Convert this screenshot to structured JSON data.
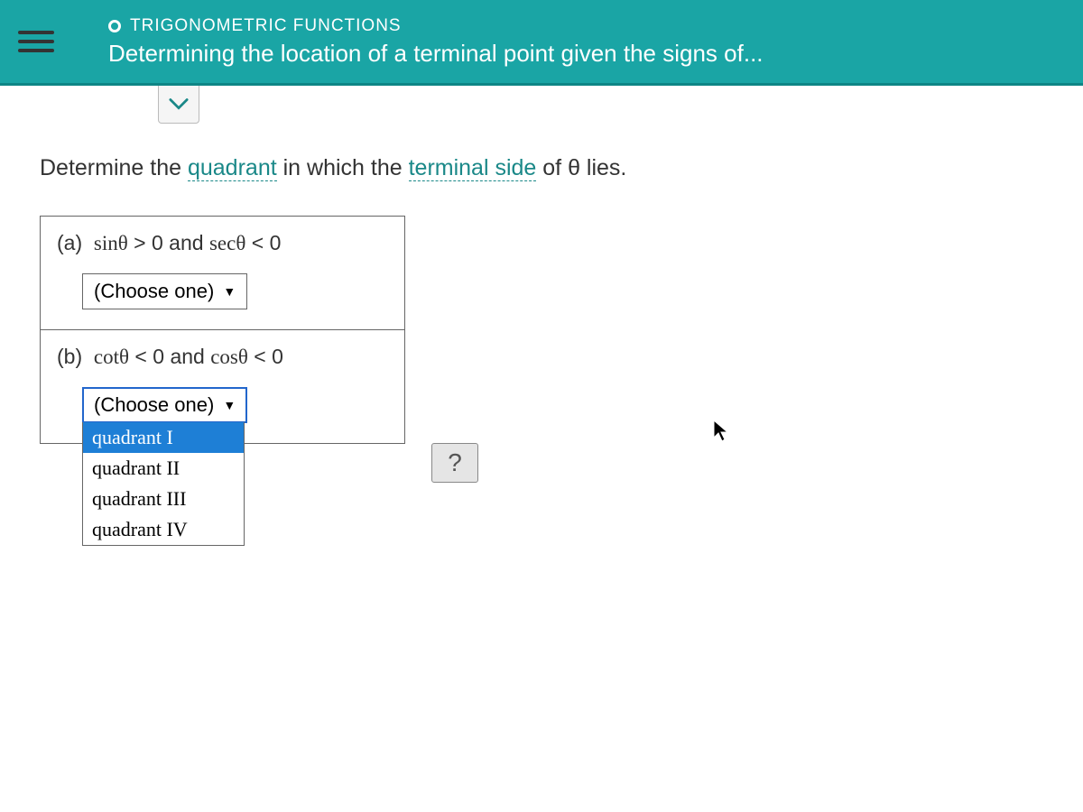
{
  "header": {
    "category": "TRIGONOMETRIC FUNCTIONS",
    "title": "Determining the location of a terminal point given the signs of..."
  },
  "question": {
    "prefix": "Determine the ",
    "link1": "quadrant",
    "mid": " in which the ",
    "link2": "terminal side",
    "suffix": " of θ lies."
  },
  "partA": {
    "label": "(a)",
    "expr_pre": "sin",
    "expr_mid": " > 0 and ",
    "expr2_pre": "sec",
    "expr_post": " < 0",
    "dropdown_label": "(Choose one)"
  },
  "partB": {
    "label": "(b)",
    "expr_pre": "cot",
    "expr_mid": " < 0 and ",
    "expr2_pre": "cos",
    "expr_post": " < 0",
    "dropdown_label": "(Choose one)",
    "options": [
      "quadrant I",
      "quadrant II",
      "quadrant III",
      "quadrant IV"
    ]
  },
  "help_label": "?"
}
